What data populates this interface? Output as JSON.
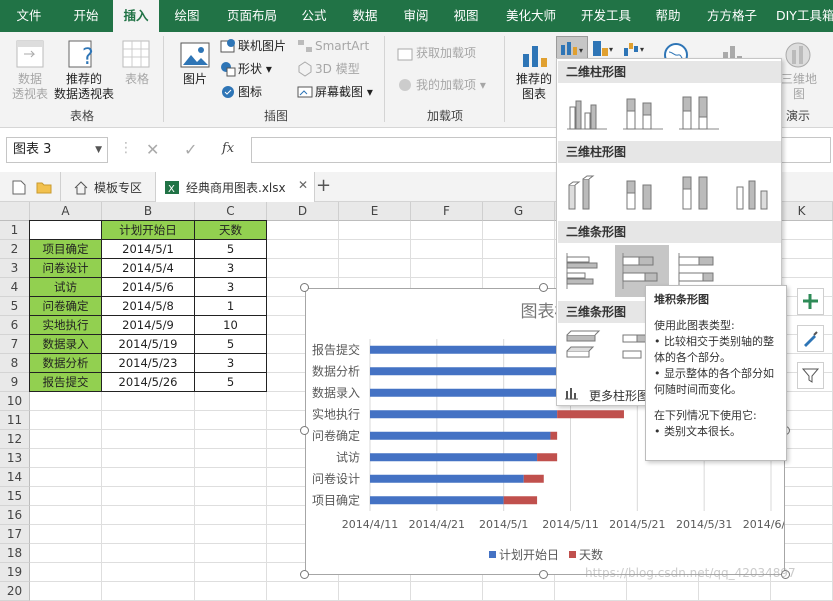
{
  "tabs": [
    "文件",
    "开始",
    "插入",
    "绘图",
    "页面布局",
    "公式",
    "数据",
    "审阅",
    "视图",
    "美化大师",
    "开发工具",
    "帮助",
    "方方格子",
    "DIY工具箱"
  ],
  "ribbon": {
    "pivot": "数据\n透视表",
    "recommended_pivot": "推荐的\n数据透视表",
    "table": "表格",
    "group_tables": "表格",
    "picture": "图片",
    "online_picture": "联机图片",
    "shapes": "形状",
    "icons": "图标",
    "smartart": "SmartArt",
    "model3d": "3D 模型",
    "screenshot": "屏幕截图",
    "group_illustrations": "插图",
    "get_addins": "获取加载项",
    "my_addins": "我的加载项",
    "group_addins": "加载项",
    "recommended_charts": "推荐的\n图表",
    "map3d": "三维地\n图",
    "group_tours": "演示"
  },
  "namebox": "图表 3",
  "formula_fx": "fx",
  "file_tabs": {
    "template": "模板专区",
    "workbook": "经典商用图表.xlsx",
    "add": "+"
  },
  "columns": [
    "A",
    "B",
    "C",
    "D",
    "E",
    "F",
    "G",
    "H",
    "I",
    "J",
    "K"
  ],
  "rows": [
    "1",
    "2",
    "3",
    "4",
    "5",
    "6",
    "7",
    "8",
    "9",
    "10",
    "11",
    "12",
    "13",
    "14",
    "15",
    "16",
    "17",
    "18",
    "19",
    "20"
  ],
  "table": {
    "headers": [
      "",
      "计划开始日",
      "天数"
    ],
    "rows": [
      [
        "项目确定",
        "2014/5/1",
        "5"
      ],
      [
        "问卷设计",
        "2014/5/4",
        "3"
      ],
      [
        "试访",
        "2014/5/6",
        "3"
      ],
      [
        "问卷确定",
        "2014/5/8",
        "1"
      ],
      [
        "实地执行",
        "2014/5/9",
        "10"
      ],
      [
        "数据录入",
        "2014/5/19",
        "5"
      ],
      [
        "数据分析",
        "2014/5/23",
        "3"
      ],
      [
        "报告提交",
        "2014/5/26",
        "5"
      ]
    ]
  },
  "chart_data": {
    "type": "bar",
    "stacked": true,
    "orientation": "horizontal",
    "title": "图表标",
    "categories": [
      "项目确定",
      "问卷设计",
      "试访",
      "问卷确定",
      "实地执行",
      "数据录入",
      "数据分析",
      "报告提交"
    ],
    "x_ticks": [
      "2014/4/11",
      "2014/4/21",
      "2014/5/1",
      "2014/5/11",
      "2014/5/21",
      "2014/5/31",
      "2014/6/10"
    ],
    "xlim": [
      "2014/4/11",
      "2014/6/10"
    ],
    "series": [
      {
        "name": "计划开始日",
        "color": "#4472c4",
        "values": [
          "2014/5/1",
          "2014/5/4",
          "2014/5/6",
          "2014/5/8",
          "2014/5/9",
          "2014/5/19",
          "2014/5/23",
          "2014/5/26"
        ]
      },
      {
        "name": "天数",
        "color": "#c0504d",
        "values": [
          5,
          3,
          3,
          1,
          10,
          5,
          3,
          5
        ]
      }
    ],
    "legend": "bottom",
    "grid": true
  },
  "dropdown": {
    "sec1": "二维柱形图",
    "sec2": "三维柱形图",
    "sec3": "二维条形图",
    "sec4": "三维条形图",
    "more": "更多柱形图(M)..."
  },
  "tooltip": {
    "title": "堆积条形图",
    "l1": "使用此图表类型:",
    "l2": "• 比较相交于类别轴的整体的各个部分。",
    "l3": "• 显示整体的各个部分如何随时间而变化。",
    "l4": "在下列情况下使用它:",
    "l5": "• 类别文本很长。"
  },
  "watermark": "https://blog.csdn.net/qq_42034897"
}
